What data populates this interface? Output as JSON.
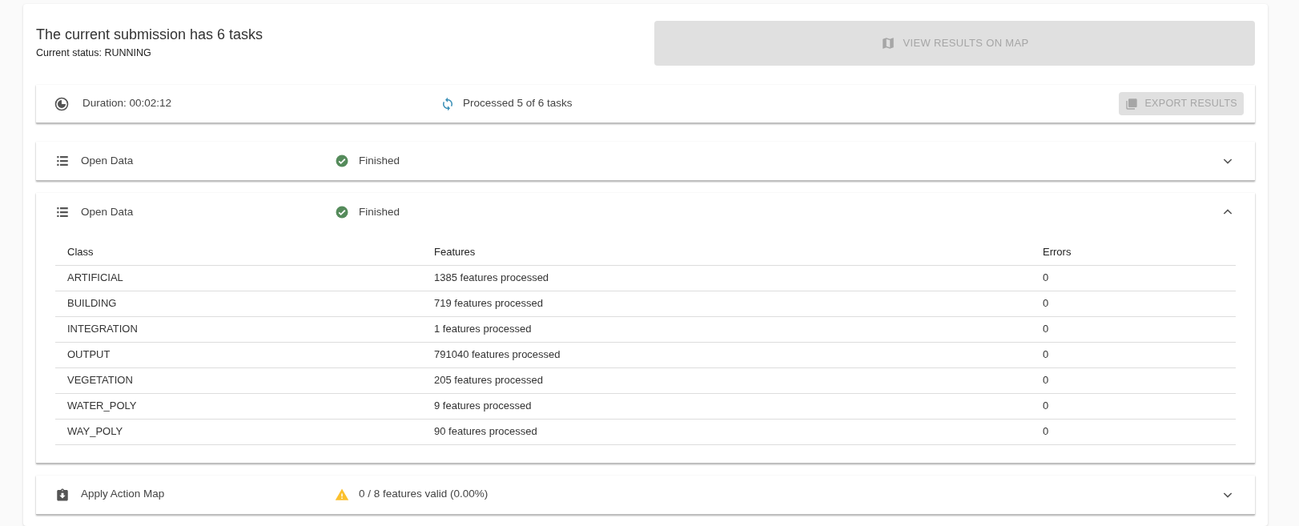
{
  "header": {
    "title": "The current submission has 6 tasks",
    "status": "Current status: RUNNING"
  },
  "view_button": {
    "label": "VIEW RESULTS ON MAP",
    "disabled": true
  },
  "summary": {
    "duration": "Duration: 00:02:12",
    "progress": "Processed 5 of 6 tasks",
    "export_button": {
      "label": "EXPORT RESULTS",
      "disabled": true
    }
  },
  "tasks": [
    {
      "kind": "data",
      "name": "Open Data",
      "status": {
        "kind": "success",
        "text": "Finished"
      },
      "expanded": false
    },
    {
      "kind": "data",
      "name": "Open Data",
      "status": {
        "kind": "success",
        "text": "Finished"
      },
      "expanded": true,
      "table": {
        "columns": [
          "Class",
          "Features",
          "Errors"
        ],
        "rows": [
          [
            "ARTIFICIAL",
            "1385 features processed",
            "0"
          ],
          [
            "BUILDING",
            "719 features processed",
            "0"
          ],
          [
            "INTEGRATION",
            "1 features processed",
            "0"
          ],
          [
            "OUTPUT",
            "791040 features processed",
            "0"
          ],
          [
            "VEGETATION",
            "205 features processed",
            "0"
          ],
          [
            "WATER_POLY",
            "9 features processed",
            "0"
          ],
          [
            "WAY_POLY",
            "90 features processed",
            "0"
          ]
        ]
      }
    },
    {
      "kind": "action",
      "name": "Apply Action Map",
      "status": {
        "kind": "warning",
        "text": "0 / 8 features valid (0.00%)"
      },
      "expanded": false
    }
  ]
}
